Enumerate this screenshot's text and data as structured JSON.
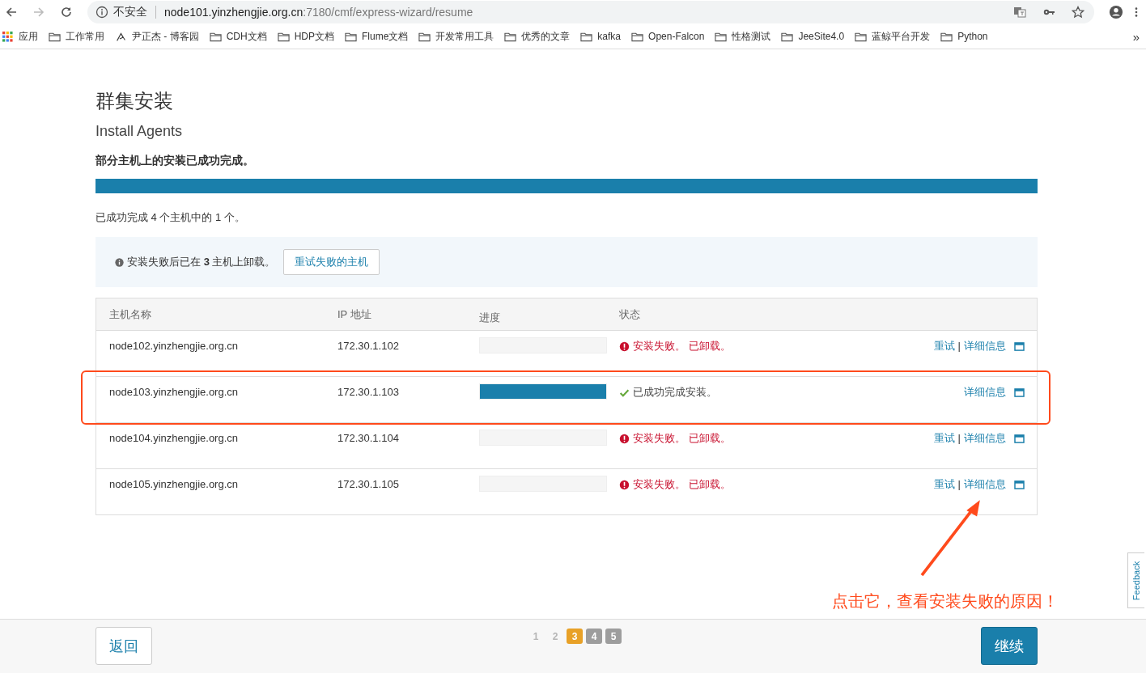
{
  "browser": {
    "security": "不安全",
    "host": "node101.yinzhengjie.org.cn",
    "path": ":7180/cmf/express-wizard/resume",
    "bookmarks": [
      {
        "kind": "apps",
        "label": "应用"
      },
      {
        "kind": "folder",
        "label": "工作常用"
      },
      {
        "kind": "site",
        "label": "尹正杰 - 博客园"
      },
      {
        "kind": "folder",
        "label": "CDH文档"
      },
      {
        "kind": "folder",
        "label": "HDP文档"
      },
      {
        "kind": "folder",
        "label": "Flume文档"
      },
      {
        "kind": "folder",
        "label": "开发常用工具"
      },
      {
        "kind": "folder",
        "label": "优秀的文章"
      },
      {
        "kind": "folder",
        "label": "kafka"
      },
      {
        "kind": "folder",
        "label": "Open-Falcon"
      },
      {
        "kind": "folder",
        "label": "性格测试"
      },
      {
        "kind": "folder",
        "label": "JeeSite4.0"
      },
      {
        "kind": "folder",
        "label": "蓝鲸平台开发"
      },
      {
        "kind": "folder",
        "label": "Python"
      }
    ],
    "overflow": "»"
  },
  "page": {
    "title": "群集安装",
    "subtitle": "Install Agents",
    "message": "部分主机上的安装已成功完成。",
    "level": 1,
    "summary": "已成功完成 4 个主机中的 1 个。"
  },
  "alert": {
    "text": "安装失败后已在 **3** 主机上卸载。",
    "button": "重试失败的主机"
  },
  "table": {
    "columns": [
      "主机名称",
      "IP 地址",
      "进度",
      "状态"
    ],
    "separator": "|",
    "rows": [
      {
        "host": "node102.yinzhengjie.org.cn",
        "ip": "172.30.1.102",
        "level": 0,
        "status": {
          "kind": "failed",
          "text": "安装失败。 已卸载。"
        },
        "actions": [
          "重试",
          "详细信息"
        ],
        "highlighted": false
      },
      {
        "host": "node103.yinzhengjie.org.cn",
        "ip": "172.30.1.103",
        "level": 1,
        "status": {
          "kind": "success",
          "text": "已成功完成安装。"
        },
        "actions": [
          "详细信息"
        ],
        "highlighted": true
      },
      {
        "host": "node104.yinzhengjie.org.cn",
        "ip": "172.30.1.104",
        "level": 0,
        "status": {
          "kind": "failed",
          "text": "安装失败。 已卸载。"
        },
        "actions": [
          "重试",
          "详细信息"
        ],
        "highlighted": false
      },
      {
        "host": "node105.yinzhengjie.org.cn",
        "ip": "172.30.1.105",
        "level": 0,
        "status": {
          "kind": "failed",
          "text": "安装失败。 已卸载。"
        },
        "actions": [
          "重试",
          "详细信息"
        ],
        "highlighted": false
      }
    ]
  },
  "annotation": {
    "text": "点击它，查看安装失败的原因！"
  },
  "feedback": "Feedback",
  "footer": {
    "back": "返回",
    "next": "继续",
    "steps": [
      {
        "label": "1",
        "selected": false,
        "kind": "done"
      },
      {
        "label": "2",
        "selected": false,
        "kind": "done"
      },
      {
        "label": "3",
        "selected": true,
        "kind": "current"
      },
      {
        "label": "4",
        "selected": false,
        "kind": "todo"
      },
      {
        "label": "5",
        "selected": false,
        "kind": "todo"
      }
    ]
  }
}
